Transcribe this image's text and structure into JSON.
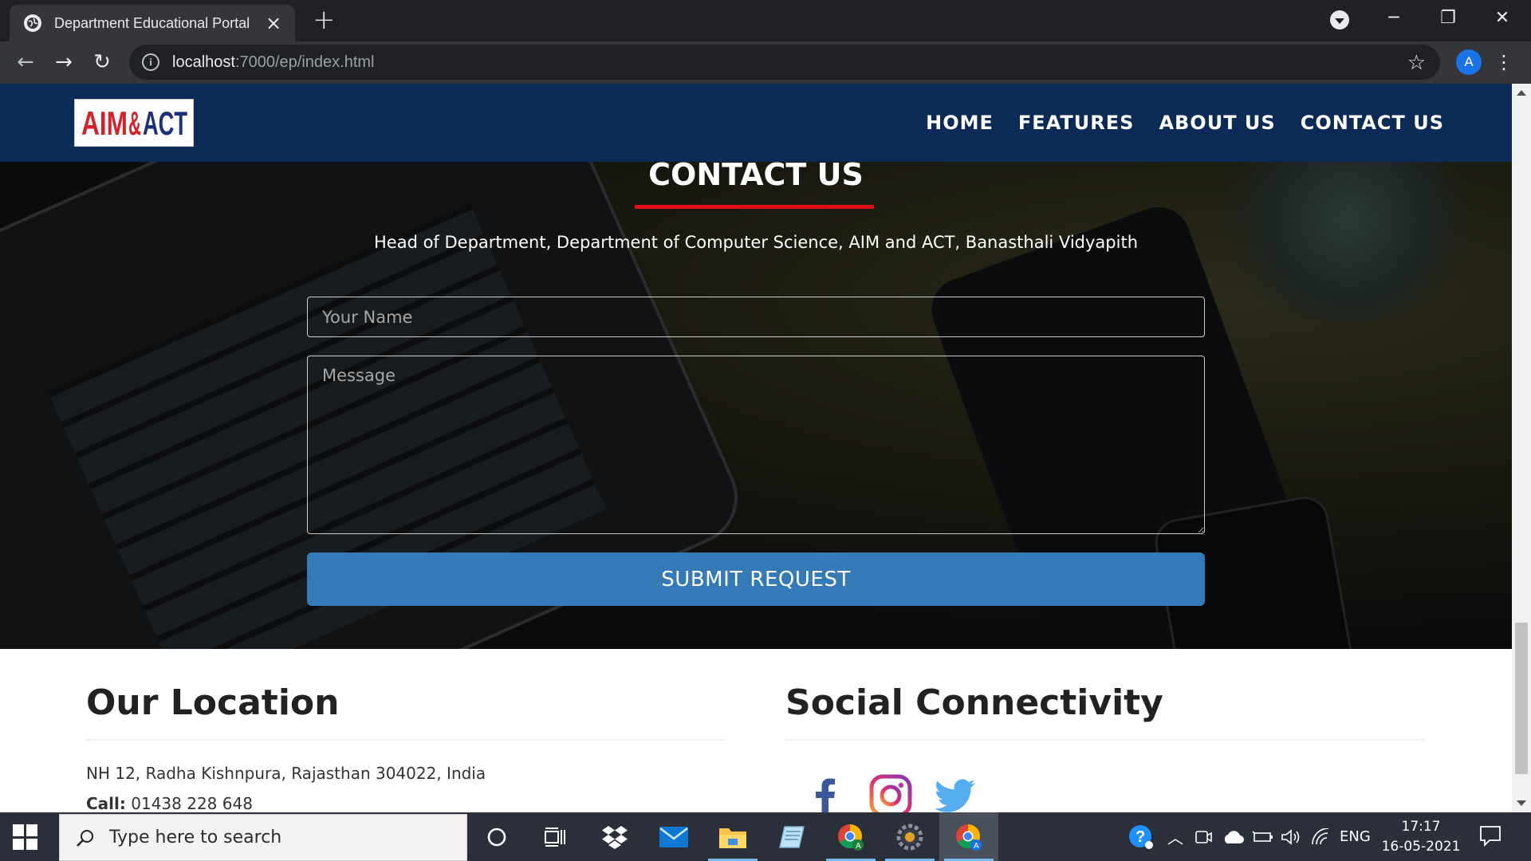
{
  "browser": {
    "tab_title": "Department Educational Portal",
    "url_host": "localhost",
    "url_path": ":7000/ep/index.html",
    "profile_initial": "A"
  },
  "site": {
    "logo_text": "AIM&ACT",
    "nav": [
      "HOME",
      "FEATURES",
      "ABOUT US",
      "CONTACT US"
    ]
  },
  "contact": {
    "title": "CONTACT US",
    "subtitle": "Head of Department, Department of Computer Science, AIM and ACT, Banasthali Vidyapith",
    "name_placeholder": "Your Name",
    "message_placeholder": "Message",
    "submit_label": "SUBMIT REQUEST",
    "accent_color": "#e00e17",
    "button_color": "#337ab7"
  },
  "footer": {
    "location_heading": "Our Location",
    "address": "NH 12, Radha Kishnpura, Rajasthan 304022, India",
    "call_label": "Call:",
    "call_number": "01438 228 648",
    "social_heading": "Social Connectivity",
    "social_icons": [
      "facebook-icon",
      "instagram-icon",
      "twitter-icon"
    ]
  },
  "taskbar": {
    "search_placeholder": "Type here to search",
    "language": "ENG",
    "time": "17:17",
    "date": "16-05-2021"
  },
  "colors": {
    "navbar": "#0b2a55",
    "taskbar": "#2b2f3a"
  }
}
